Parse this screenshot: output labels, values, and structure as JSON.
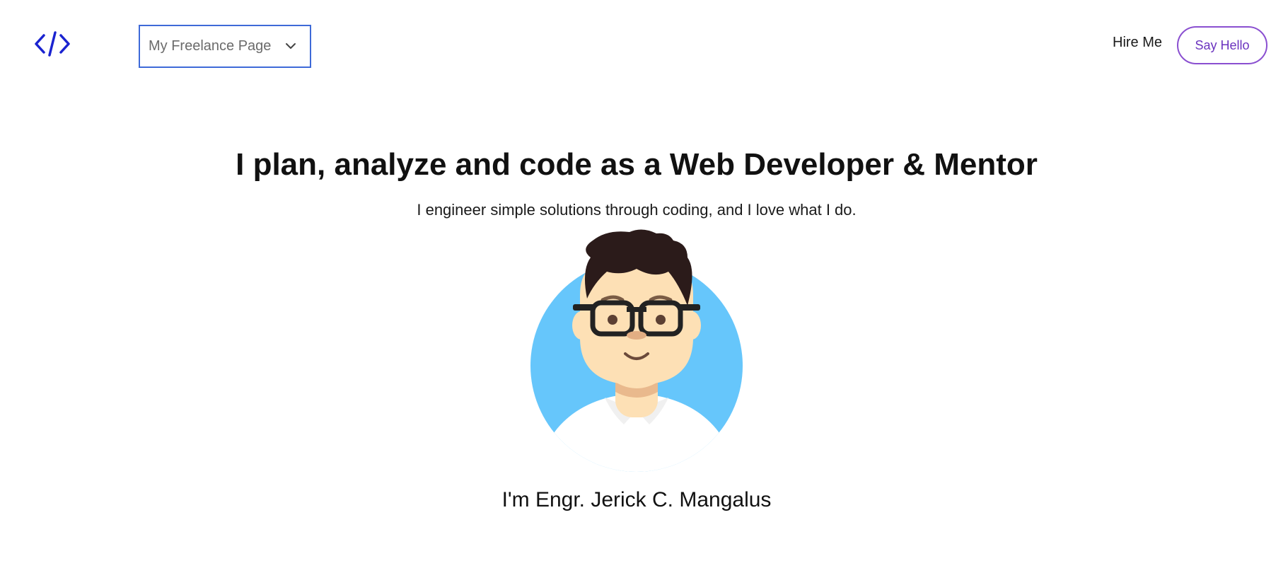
{
  "header": {
    "logo_icon": "code-brackets-icon",
    "logo_color": "#1a23d0",
    "dropdown": {
      "selected": "My Freelance Page",
      "icon": "chevron-down-icon",
      "border_color": "#3e6ad8"
    },
    "nav": {
      "hire_me": "Hire Me",
      "say_hello": "Say Hello",
      "say_hello_color": "#6b33bf"
    }
  },
  "hero": {
    "title": "I plan, analyze and code as a Web Developer & Mentor",
    "subtitle": "I engineer simple solutions through coding, and I love what I do.",
    "avatar_icon": "developer-avatar-illustration",
    "avatar_bg_color": "#66c6fb",
    "name": "I'm Engr. Jerick C. Mangalus"
  }
}
